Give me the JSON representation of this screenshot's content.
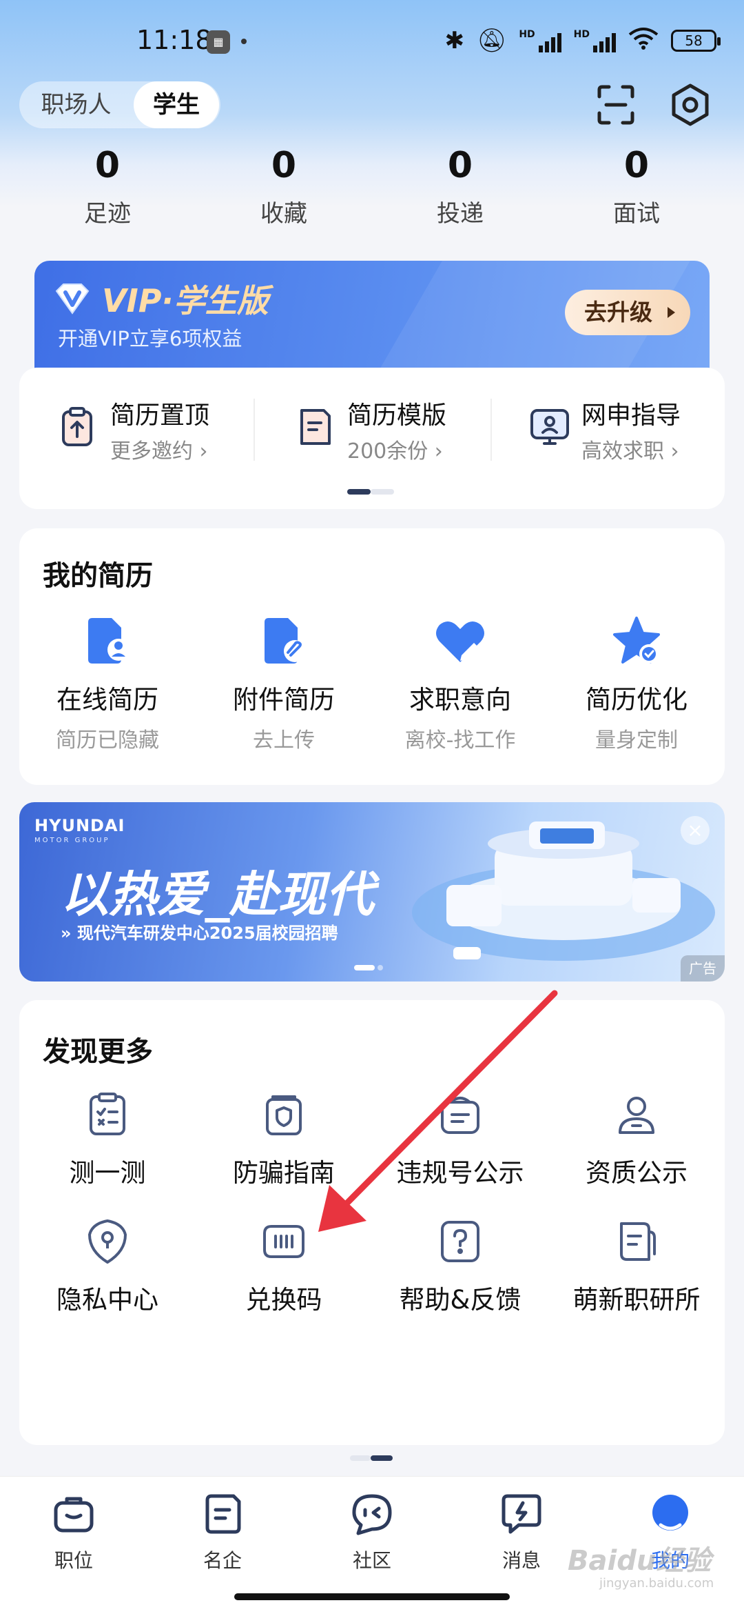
{
  "status_bar": {
    "time": "11:18",
    "battery": "58",
    "network": "HD"
  },
  "header": {
    "role_tabs": [
      "职场人",
      "学生"
    ],
    "selected_role": "学生"
  },
  "stats": [
    {
      "value": "0",
      "label": "足迹"
    },
    {
      "value": "0",
      "label": "收藏"
    },
    {
      "value": "0",
      "label": "投递"
    },
    {
      "value": "0",
      "label": "面试"
    }
  ],
  "vip": {
    "title": "VIP·学生版",
    "subtitle": "开通VIP立享6项权益",
    "button": "去升级"
  },
  "quick_actions": [
    {
      "title": "简历置顶",
      "subtitle": "更多邀约 ›",
      "icon": "clipboard-up-icon"
    },
    {
      "title": "简历模版",
      "subtitle": "200余份 ›",
      "icon": "document-template-icon"
    },
    {
      "title": "网申指导",
      "subtitle": "高效求职 ›",
      "icon": "monitor-person-icon"
    }
  ],
  "my_resume": {
    "title": "我的简历",
    "items": [
      {
        "label": "在线简历",
        "sub": "简历已隐藏",
        "icon": "online-resume-icon"
      },
      {
        "label": "附件简历",
        "sub": "去上传",
        "icon": "attachment-resume-icon"
      },
      {
        "label": "求职意向",
        "sub": "离校-找工作",
        "icon": "heart-edit-icon"
      },
      {
        "label": "简历优化",
        "sub": "量身定制",
        "icon": "star-check-icon"
      }
    ]
  },
  "ad": {
    "brand": "HYUNDAI",
    "brand_sub": "MOTOR GROUP",
    "slogan": "以热爱_赴现代",
    "line": "» 现代汽车研发中心2025届校园招聘",
    "tag": "广告",
    "close": "×"
  },
  "discover": {
    "title": "发现更多",
    "items": [
      {
        "label": "测一测",
        "icon": "test-checklist-icon"
      },
      {
        "label": "防骗指南",
        "icon": "shield-guide-icon"
      },
      {
        "label": "违规号公示",
        "icon": "violation-notice-icon"
      },
      {
        "label": "资质公示",
        "icon": "qualification-person-icon"
      },
      {
        "label": "隐私中心",
        "icon": "privacy-shield-icon"
      },
      {
        "label": "兑换码",
        "icon": "redeem-code-icon"
      },
      {
        "label": "帮助&反馈",
        "icon": "help-question-icon"
      },
      {
        "label": "萌新职研所",
        "icon": "newbie-doc-icon"
      }
    ]
  },
  "bottom_nav": [
    {
      "label": "职位",
      "icon": "briefcase-icon"
    },
    {
      "label": "名企",
      "icon": "company-icon"
    },
    {
      "label": "社区",
      "icon": "community-chat-icon"
    },
    {
      "label": "消息",
      "icon": "message-icon"
    },
    {
      "label": "我的",
      "icon": "profile-icon",
      "active": true
    }
  ],
  "watermark": {
    "main": "Baidu经验",
    "sub": "jingyan.baidu.com"
  },
  "colors": {
    "accent": "#2c6df0",
    "icon_blue": "#3d7bf2",
    "vip_gold": "#ffdca6",
    "annotation_red": "#e8343f"
  }
}
